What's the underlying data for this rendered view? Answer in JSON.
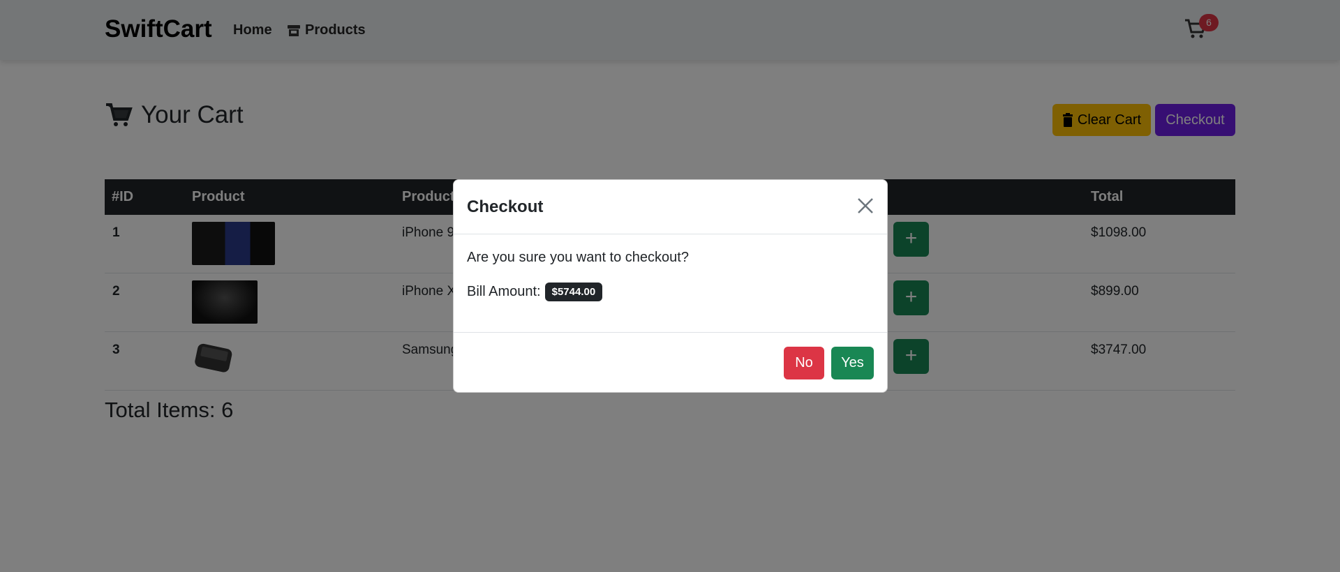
{
  "navbar": {
    "brand": "SwiftCart",
    "links": [
      {
        "label": "Home",
        "icon": "none"
      },
      {
        "label": "Products",
        "icon": "store-icon"
      }
    ],
    "cart_count": "6"
  },
  "page": {
    "title": "Your Cart",
    "clear_label": "Clear Cart",
    "checkout_label": "Checkout"
  },
  "table": {
    "headers": [
      "#ID",
      "Product",
      "Product",
      "Total"
    ],
    "rows": [
      {
        "id": "1",
        "name": "iPhone 9",
        "total": "$1098.00",
        "plus": "+"
      },
      {
        "id": "2",
        "name": "iPhone X",
        "total": "$899.00",
        "plus": "+"
      },
      {
        "id": "3",
        "name": "Samsung",
        "total": "$3747.00",
        "plus": "+"
      }
    ]
  },
  "total_items": "Total Items: 6",
  "modal": {
    "title": "Checkout",
    "question": "Are you sure you want to checkout?",
    "bill_label": "Bill Amount:",
    "bill_amount": "$5744.00",
    "no_label": "No",
    "yes_label": "Yes"
  },
  "colors": {
    "brand": "#000000",
    "badge": "#dc3545",
    "warning": "#ffc107",
    "checkout": "#6f1fe6",
    "success": "#198754",
    "danger": "#dc3545",
    "table_head": "#212529"
  }
}
